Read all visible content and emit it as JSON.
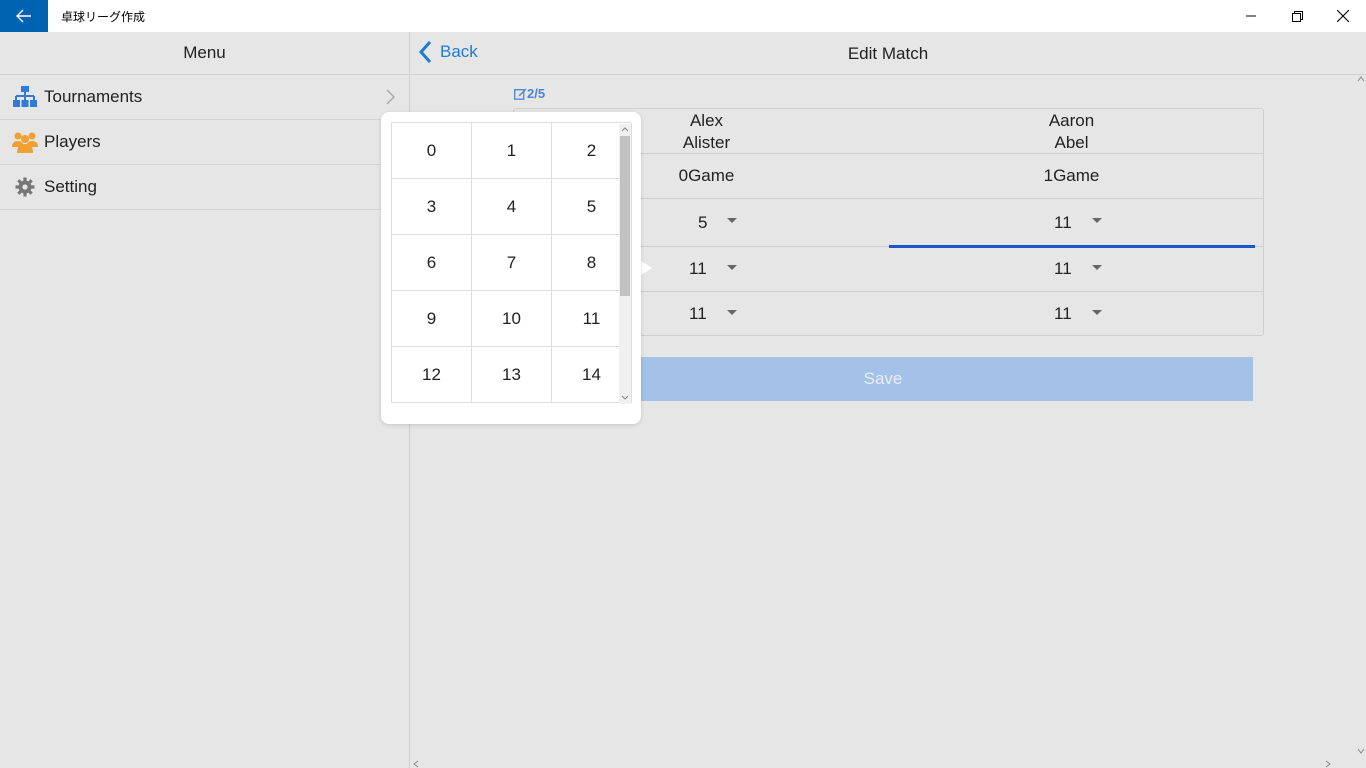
{
  "window": {
    "title": "卓球リーグ作成",
    "back_icon": "arrow-left-icon",
    "minimize_icon": "minimize-icon",
    "maximize_icon": "restore-icon",
    "close_icon": "close-icon"
  },
  "menu": {
    "header": "Menu",
    "items": [
      {
        "label": "Tournaments",
        "icon": "tournament-tree-icon",
        "color": "#2f7bd8"
      },
      {
        "label": "Players",
        "icon": "users-icon",
        "color": "#f0a030"
      },
      {
        "label": "Setting",
        "icon": "gear-icon",
        "color": "#777777"
      }
    ]
  },
  "header": {
    "back_label": "Back",
    "title": "Edit Match"
  },
  "match": {
    "game_count": "2/5",
    "player_left": {
      "first": "Alex",
      "last": "Alister",
      "games": "0Game"
    },
    "player_right": {
      "first": "Aaron",
      "last": "Abel",
      "games": "1Game"
    },
    "scores": [
      {
        "left": "5",
        "right": "11"
      },
      {
        "left": "11",
        "right": "11"
      },
      {
        "left": "11",
        "right": "11"
      }
    ],
    "save_label": "Save"
  },
  "picker": {
    "options": [
      "0",
      "1",
      "2",
      "3",
      "4",
      "5",
      "6",
      "7",
      "8",
      "9",
      "10",
      "11",
      "12",
      "13",
      "14"
    ]
  },
  "colors": {
    "accent": "#1e7bd8",
    "title_bar_back": "#0063b1",
    "save_disabled": "#a4c2e8",
    "focus_underline": "#1a56c9"
  }
}
